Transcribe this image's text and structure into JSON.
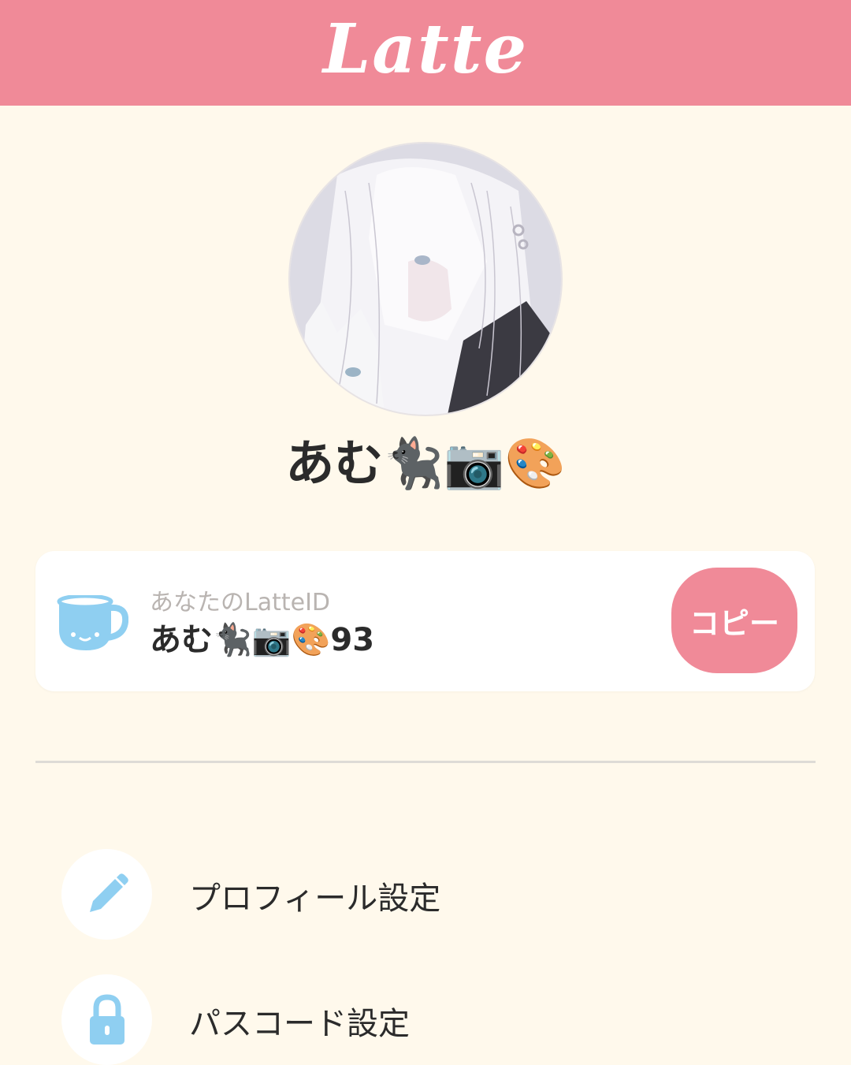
{
  "header": {
    "logo_text": "Latte"
  },
  "profile": {
    "display_name": "あむ🐈‍⬛📷🎨"
  },
  "id_card": {
    "label": "あなたのLatteID",
    "value": "あむ🐈‍⬛📷🎨93",
    "copy_label": "コピー"
  },
  "menu": {
    "items": [
      {
        "label": "プロフィール設定",
        "icon": "pencil-icon"
      },
      {
        "label": "パスコード設定",
        "icon": "lock-icon"
      }
    ]
  },
  "colors": {
    "brand_pink": "#f08a98",
    "background": "#fff9ec",
    "icon_blue": "#8fcff1"
  }
}
